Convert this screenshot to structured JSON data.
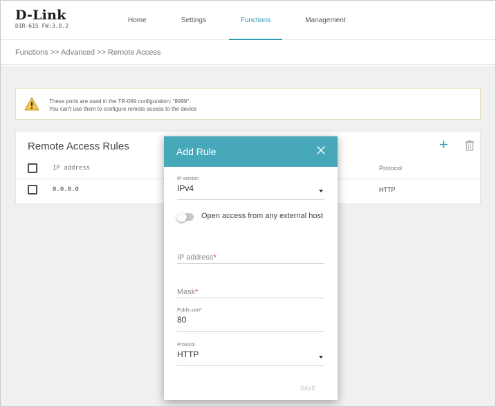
{
  "brand": {
    "logo": "D-Link",
    "firmware": "DIR-615 FW:3.0.2"
  },
  "nav": {
    "items": [
      "Home",
      "Settings",
      "Functions",
      "Management"
    ],
    "active": "Functions"
  },
  "breadcrumb": "Functions >> Advanced >> Remote Access",
  "warning": {
    "line1": "These ports are used in the TR-069 configuration: \"8999\".",
    "line2": "You can't use them to configure remote access to the device"
  },
  "rules": {
    "title": "Remote Access Rules",
    "columns": {
      "ip": "IP address",
      "protocol": "Protocol"
    },
    "rows": [
      {
        "ip": "0.0.0.0",
        "protocol": "HTTP"
      }
    ]
  },
  "modal": {
    "title": "Add Rule",
    "ip_version": {
      "label": "IP version",
      "value": "IPv4"
    },
    "open_access": {
      "label": "Open access from any external host",
      "on": false
    },
    "ip_address": {
      "label": "IP address",
      "required": "*"
    },
    "mask": {
      "label": "Mask",
      "required": "*"
    },
    "public_port": {
      "label": "Public port",
      "required": "*",
      "value": "80"
    },
    "protocol": {
      "label": "Protocol",
      "value": "HTTP"
    },
    "save": "SAVE"
  },
  "colors": {
    "accent": "#2a9bb0",
    "modal_header": "#47a8ba",
    "required": "#d33333"
  }
}
